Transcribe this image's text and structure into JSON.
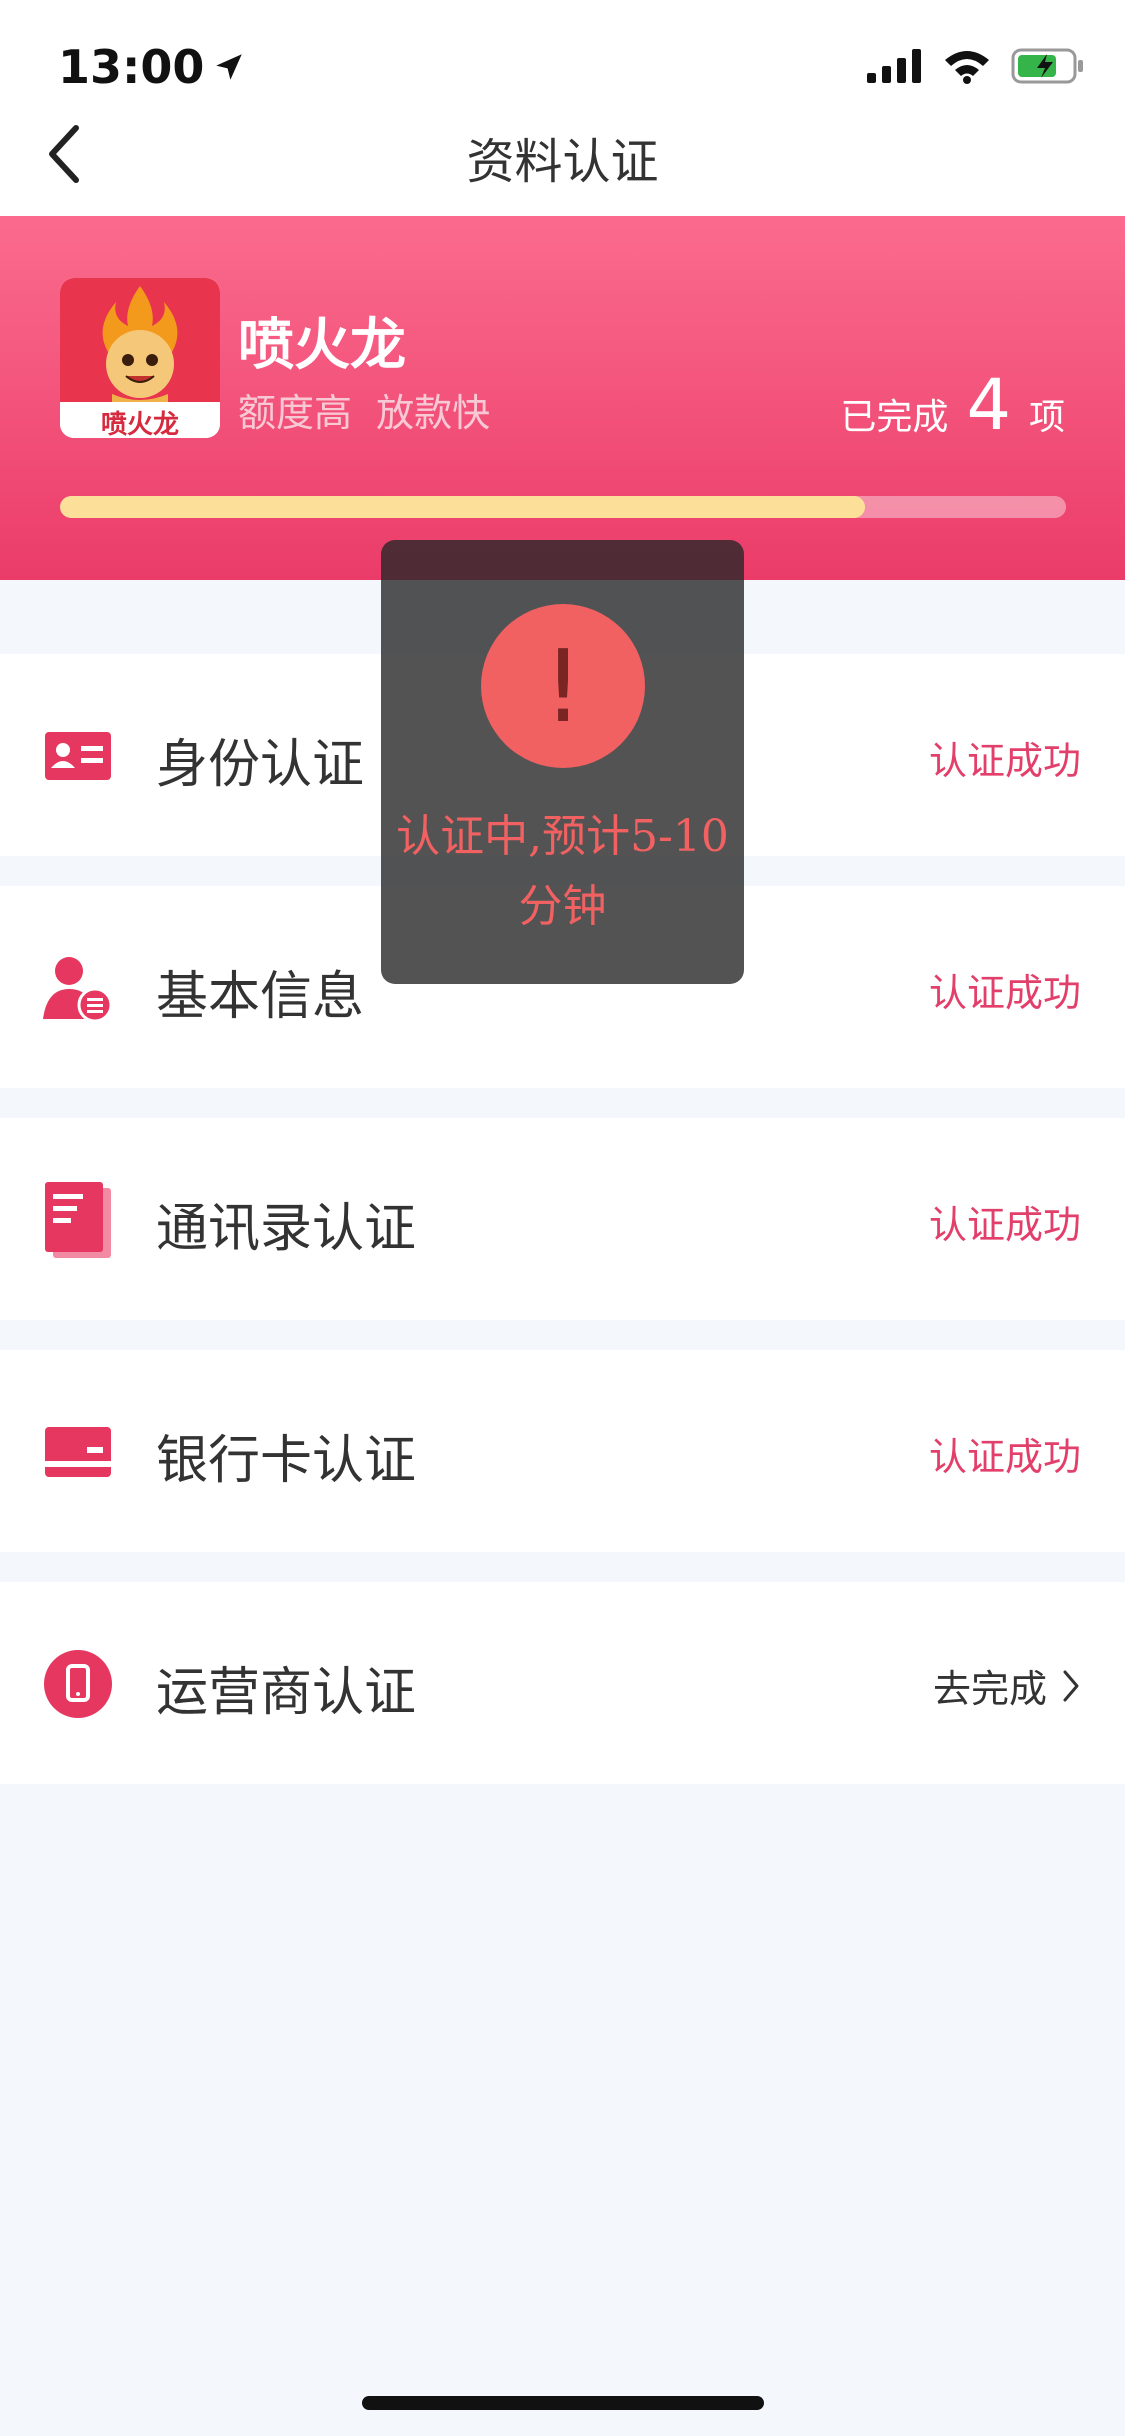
{
  "status_bar": {
    "time": "13:00"
  },
  "nav": {
    "title": "资料认证"
  },
  "hero": {
    "brand_name": "喷火龙",
    "brand_tagline": "额度高  放款快",
    "logo_text": "喷火龙",
    "completed_label": "已完成",
    "completed_count": "4",
    "completed_unit": "项",
    "progress_fraction": 0.8
  },
  "items": [
    {
      "label": "身份认证",
      "status": "认证成功",
      "icon": "id-card-icon"
    },
    {
      "label": "基本信息",
      "status": "认证成功",
      "icon": "user-info-icon"
    },
    {
      "label": "通讯录认证",
      "status": "认证成功",
      "icon": "contacts-book-icon"
    },
    {
      "label": "银行卡认证",
      "status": "认证成功",
      "icon": "bank-card-icon"
    },
    {
      "label": "运营商认证",
      "status": "去完成",
      "icon": "phone-icon"
    }
  ],
  "toast": {
    "symbol": "!",
    "message": "认证中,预计5-10分钟"
  },
  "colors": {
    "accent": "#e23f6a",
    "hero_top": "#fb6b8e",
    "hero_bottom": "#eb3c69",
    "progress": "#fce09a",
    "toast_red": "#f26162"
  }
}
